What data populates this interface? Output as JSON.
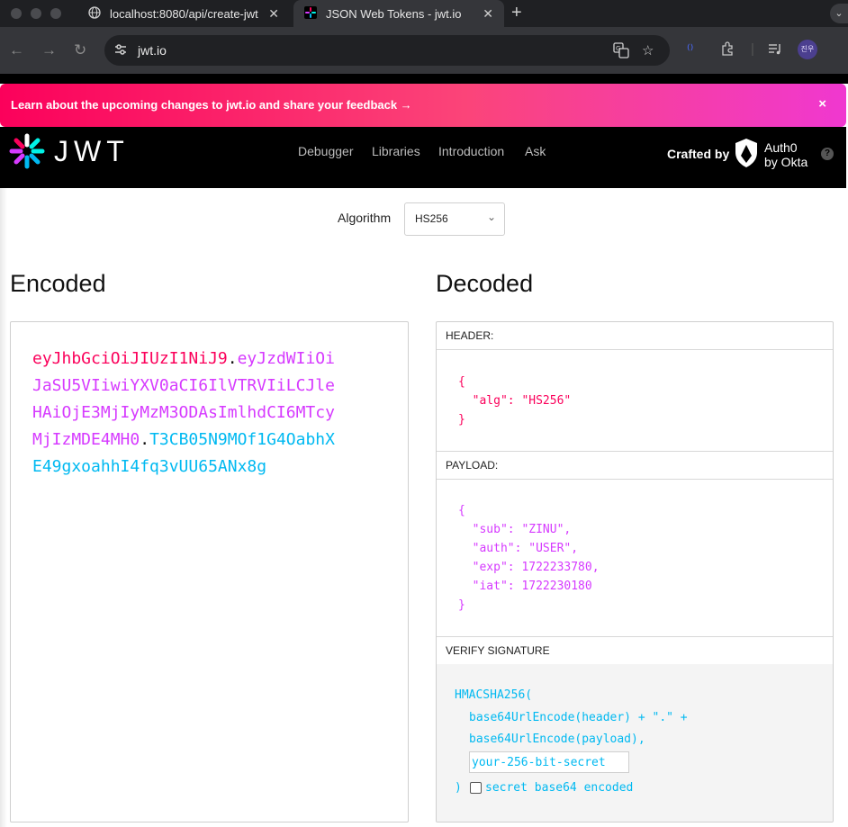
{
  "browser": {
    "tabs": [
      {
        "title": "localhost:8080/api/create-jwt",
        "icon": "globe-icon"
      },
      {
        "title": "JSON Web Tokens - jwt.io",
        "icon": "jwt-favicon"
      }
    ],
    "url": "jwt.io",
    "profile_initials": "진우"
  },
  "banner": {
    "text": "Learn about the upcoming changes to jwt.io and share your feedback →",
    "close": "×",
    "colors": [
      "#fb015b",
      "#f038d0"
    ]
  },
  "header": {
    "logo_text": "JWT",
    "nav": [
      "Debugger",
      "Libraries",
      "Introduction",
      "Ask"
    ],
    "crafted_by": "Crafted by",
    "auth0_line1": "Auth0",
    "auth0_line2": "by Okta",
    "help": "?"
  },
  "algorithm": {
    "label": "Algorithm",
    "value": "HS256"
  },
  "encoded": {
    "title": "Encoded",
    "header": "eyJhbGciOiJIUzI1NiJ9",
    "payload": "eyJzdWIiOiJaSU5VIiwiYXV0aCI6IlVTRVIiLCJleHAiOjE3MjIyMzM3ODAsImlhdCI6MTcyMjIzMDE4MH0",
    "signature": "T3CB05N9MOf1G4OabhXE49gxoahhI4fq3vUU65ANx8g",
    "dot": "."
  },
  "decoded": {
    "title": "Decoded",
    "header_label": "HEADER:",
    "header_json": "{\n  \"alg\": \"HS256\"\n}",
    "payload_label": "PAYLOAD:",
    "payload_json": "{\n  \"sub\": \"ZINU\",\n  \"auth\": \"USER\",\n  \"exp\": 1722233780,\n  \"iat\": 1722230180\n}",
    "verify_label": "VERIFY SIGNATURE",
    "verify_line1": "HMACSHA256(",
    "verify_line2": "base64UrlEncode(header) + \".\" +",
    "verify_line3": "base64UrlEncode(payload),",
    "secret_placeholder": "your-256-bit-secret",
    "verify_close": ")",
    "secret_base64_label": "secret base64 encoded"
  },
  "colors": {
    "header_token": "#fb015b",
    "payload_token": "#d63aff",
    "signature_token": "#00b9f1"
  }
}
